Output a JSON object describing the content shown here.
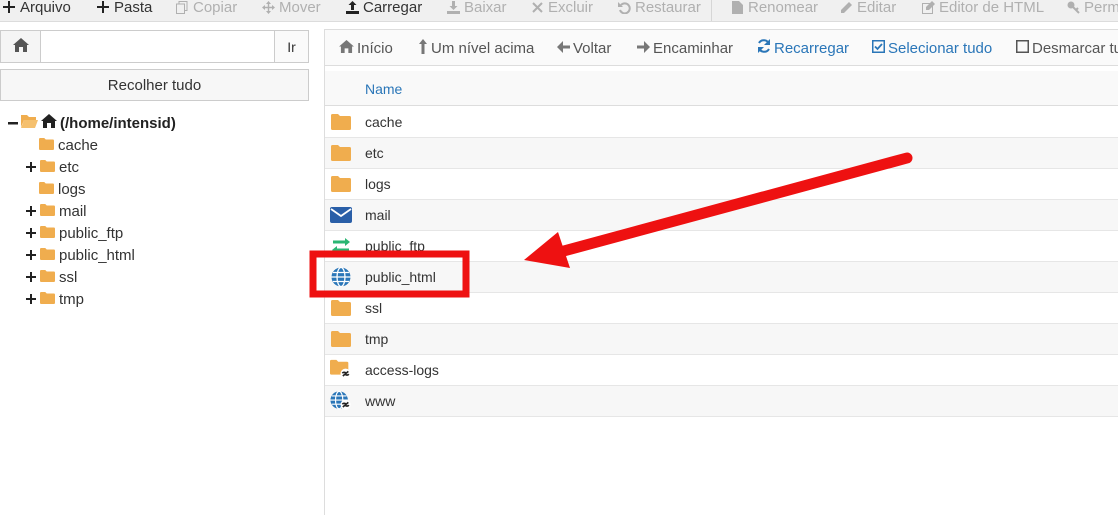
{
  "toolbar": {
    "items": [
      {
        "label": "Arquivo",
        "icon": "plus-icon",
        "enabled": true
      },
      {
        "label": "Pasta",
        "icon": "plus-icon",
        "enabled": true
      },
      {
        "label": "Copiar",
        "icon": "copy-icon",
        "enabled": false
      },
      {
        "label": "Mover",
        "icon": "move-icon",
        "enabled": false
      },
      {
        "label": "Carregar",
        "icon": "upload-icon",
        "enabled": true
      },
      {
        "label": "Baixar",
        "icon": "download-icon",
        "enabled": false
      },
      {
        "label": "Excluir",
        "icon": "close-icon",
        "enabled": false
      },
      {
        "label": "Restaurar",
        "icon": "undo-icon",
        "enabled": false
      },
      {
        "label": "Renomear",
        "icon": "file-icon",
        "enabled": false
      },
      {
        "label": "Editar",
        "icon": "pencil-icon",
        "enabled": false
      },
      {
        "label": "Editor de HTML",
        "icon": "pencil-square-icon",
        "enabled": false
      },
      {
        "label": "Perm",
        "icon": "key-icon",
        "enabled": false
      }
    ]
  },
  "left": {
    "go_label": "Ir",
    "path_value": "",
    "collapse_label": "Recolher tudo",
    "root_label": "(/home/intensid)",
    "tree": [
      {
        "label": "cache",
        "expandable": false
      },
      {
        "label": "etc",
        "expandable": true
      },
      {
        "label": "logs",
        "expandable": false
      },
      {
        "label": "mail",
        "expandable": true
      },
      {
        "label": "public_ftp",
        "expandable": true
      },
      {
        "label": "public_html",
        "expandable": true
      },
      {
        "label": "ssl",
        "expandable": true
      },
      {
        "label": "tmp",
        "expandable": true
      }
    ]
  },
  "right": {
    "toolbar": [
      {
        "label": "Início",
        "icon": "home-icon"
      },
      {
        "label": "Um nível acima",
        "icon": "level-up-icon"
      },
      {
        "label": "Voltar",
        "icon": "arrow-left-icon"
      },
      {
        "label": "Encaminhar",
        "icon": "arrow-right-icon"
      },
      {
        "label": "Recarregar",
        "icon": "refresh-icon"
      },
      {
        "label": "Selecionar tudo",
        "icon": "checkbox-checked-icon"
      },
      {
        "label": "Desmarcar tudo",
        "icon": "checkbox-empty-icon"
      }
    ],
    "column_name": "Name",
    "files": [
      {
        "name": "cache",
        "icon": "folder-icon"
      },
      {
        "name": "etc",
        "icon": "folder-icon"
      },
      {
        "name": "logs",
        "icon": "folder-icon"
      },
      {
        "name": "mail",
        "icon": "envelope-icon"
      },
      {
        "name": "public_ftp",
        "icon": "transfer-icon"
      },
      {
        "name": "public_html",
        "icon": "globe-icon"
      },
      {
        "name": "ssl",
        "icon": "folder-icon"
      },
      {
        "name": "tmp",
        "icon": "folder-icon"
      },
      {
        "name": "access-logs",
        "icon": "folder-link-icon"
      },
      {
        "name": "www",
        "icon": "globe-link-icon"
      }
    ]
  },
  "colors": {
    "folder": "#f0ad4e",
    "accent_blue": "#2a76b8",
    "annotation_red": "#ee1111"
  }
}
